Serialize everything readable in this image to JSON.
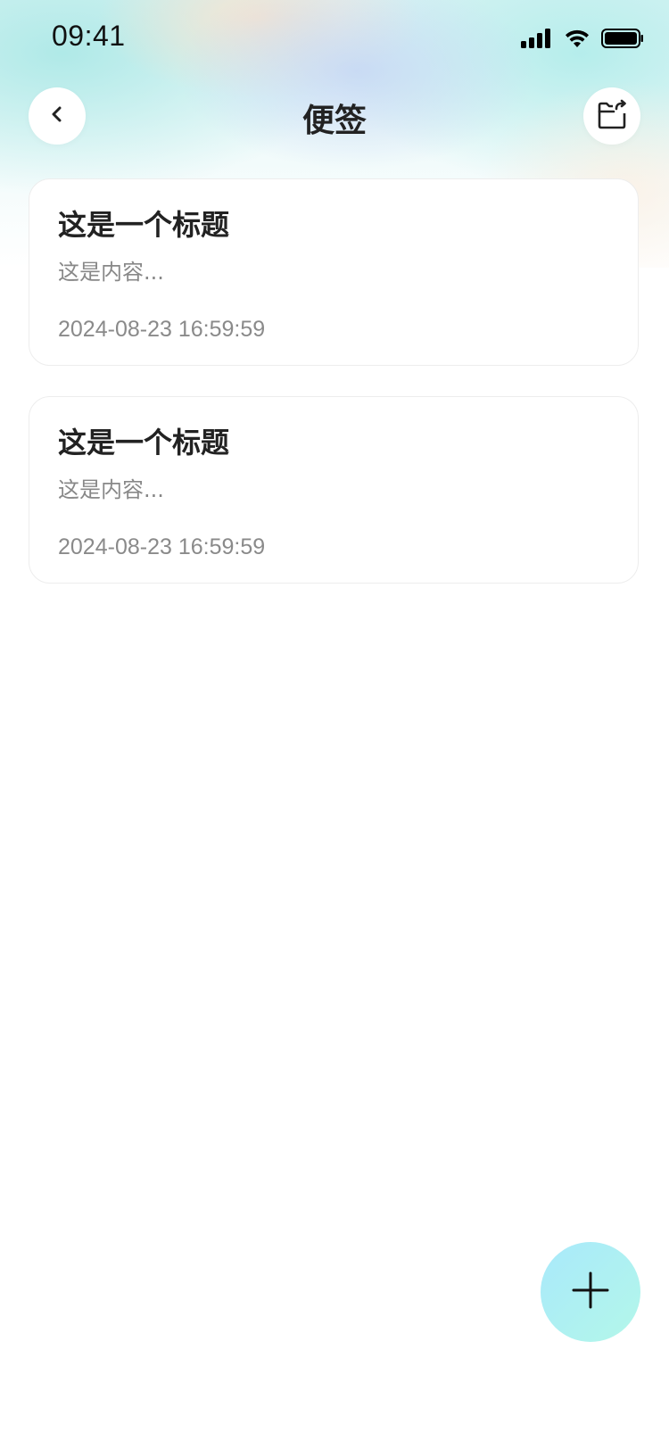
{
  "status_bar": {
    "time": "09:41"
  },
  "nav": {
    "title": "便签"
  },
  "notes": [
    {
      "title": "这是一个标题",
      "content": "这是内容...",
      "time": "2024-08-23 16:59:59"
    },
    {
      "title": "这是一个标题",
      "content": "这是内容...",
      "time": "2024-08-23 16:59:59"
    }
  ],
  "icons": {
    "back": "chevron-left-icon",
    "export": "folder-export-icon",
    "add": "plus-icon",
    "signal": "signal-icon",
    "wifi": "wifi-icon",
    "battery": "battery-icon"
  },
  "colors": {
    "fab_gradient_start": "#a9e9fb",
    "fab_gradient_end": "#b3f7e9",
    "title_text": "#222222",
    "secondary_text": "#888888"
  }
}
